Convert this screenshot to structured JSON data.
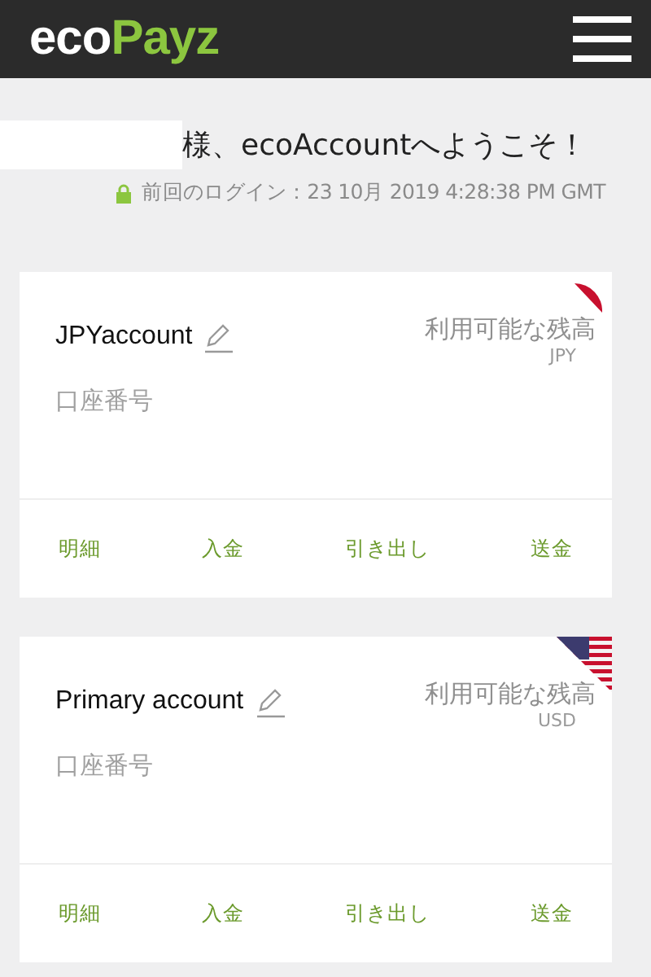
{
  "header": {
    "logo_left": "eco",
    "logo_right": "Payz"
  },
  "welcome": {
    "text": "様、ecoAccountへようこそ！",
    "name_hidden": true
  },
  "last_login": {
    "text": "前回のログイン：23 10月 2019 4:28:38 PM GMT"
  },
  "accounts": [
    {
      "name": "JPYaccount",
      "balance_label": "利用可能な残高",
      "currency": "JPY",
      "number_label": "口座番号",
      "flag": {
        "kind": "japan"
      },
      "actions": [
        "明細",
        "入金",
        "引き出し",
        "送金"
      ]
    },
    {
      "name": "Primary account",
      "balance_label": "利用可能な残高",
      "currency": "USD",
      "number_label": "口座番号",
      "flag": {
        "kind": "usa"
      },
      "actions": [
        "明細",
        "入金",
        "引き出し",
        "送金"
      ]
    }
  ]
}
